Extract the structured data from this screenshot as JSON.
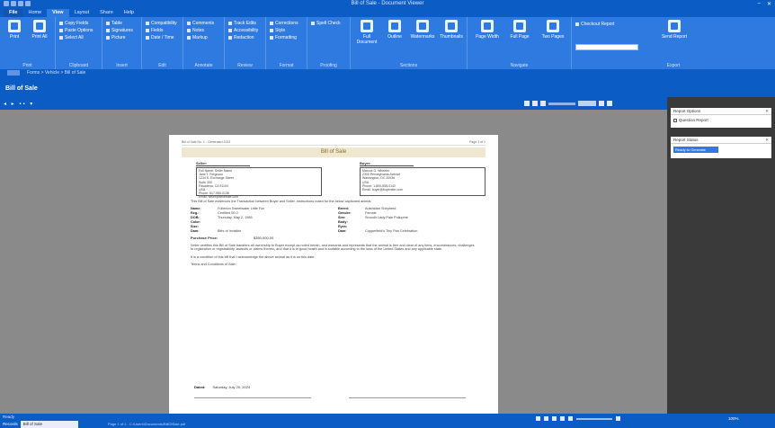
{
  "window": {
    "title": "Bill of Sale - Document Viewer"
  },
  "tabs": [
    {
      "label": "File"
    },
    {
      "label": "Home"
    },
    {
      "label": "View"
    },
    {
      "label": "Layout"
    },
    {
      "label": "Share"
    },
    {
      "label": "Help"
    }
  ],
  "ribbon": {
    "groups": [
      {
        "label": "Print",
        "buttons": [
          "Print",
          "Print All"
        ],
        "small": []
      },
      {
        "label": "Clipboard",
        "buttons": [],
        "small": [
          "Copy Fields",
          "Paste Options",
          "Select All"
        ]
      },
      {
        "label": "Insert",
        "buttons": [],
        "small": [
          "Table",
          "Signatures",
          "Picture"
        ]
      },
      {
        "label": "Edit",
        "buttons": [],
        "small": [
          "Compatibility",
          "Fields",
          "Date / Time"
        ]
      },
      {
        "label": "Annotate",
        "buttons": [],
        "small": [
          "Comments",
          "Notes",
          "Markup"
        ]
      },
      {
        "label": "Review",
        "buttons": [],
        "small": [
          "Track Edits",
          "Accessibility",
          "Redaction"
        ]
      },
      {
        "label": "Format",
        "buttons": [],
        "small": [
          "Corrections",
          "Style",
          "Formatting"
        ]
      },
      {
        "label": "Proofing",
        "buttons": [],
        "small": [
          "Spell Check"
        ]
      },
      {
        "label": "Sections",
        "buttons": [
          "Full Document",
          "Outline",
          "Watermarks",
          "Thumbnails"
        ],
        "small": []
      },
      {
        "label": "Navigate",
        "buttons": [
          "Page Width",
          "Full Page",
          "Two Pages"
        ],
        "small": []
      },
      {
        "label": "Export",
        "buttons": [
          "Send Report"
        ],
        "small": [
          "Checkout Report"
        ]
      }
    ]
  },
  "address": {
    "text": "Forms > Vehicle > Bill of Sale"
  },
  "section": {
    "title": "Bill of Sale"
  },
  "viewer": {
    "zoom": "100%"
  },
  "document": {
    "header_left": "Bill of Sale No. 1 - Generated 2024",
    "header_right": "Page 1 of 1",
    "title": "Bill of Sale",
    "seller": {
      "label": "Seller:",
      "lines": [
        "Full Name: Seller Name",
        "Jane T. Ferguson",
        "1234 S. Exchange Street",
        "Suite 300",
        "Pasadena, CA 91104",
        "USA",
        "Phone: 617-555-0136",
        "Email: seller@sellersite.com"
      ]
    },
    "buyer": {
      "label": "Buyer:",
      "lines": [
        "Marcus G. Wheeler",
        "2300 Pennsylvania Avenue",
        "Washington, DC 20036",
        "USA",
        "Phone: 1-800-555-0142",
        "Email: buyer@buyersite.com"
      ]
    },
    "intro": "This Bill of Sale evidences the Transaction between Buyer and Seller. Instructions noted for the below captioned animal.",
    "fields_left": [
      {
        "k": "Name:",
        "v": "Fullerton Sweetwater Little Fox"
      },
      {
        "k": "Reg.:",
        "v": "Certified 00-0"
      },
      {
        "k": "DOB:",
        "v": "Thursday, May 2, 1985"
      },
      {
        "k": "Color:",
        "v": ""
      },
      {
        "k": "Size:",
        "v": ""
      },
      {
        "k": "Dam:",
        "v": "Bitts of Invisible"
      }
    ],
    "fields_right": [
      {
        "k": "Breed:",
        "v": "Australian Shepherd"
      },
      {
        "k": "Gender:",
        "v": "Female"
      },
      {
        "k": "Sire:",
        "v": "Smooth Lady Pale Pullupme"
      },
      {
        "k": "Body:",
        "v": ""
      },
      {
        "k": "Eyes:",
        "v": ""
      },
      {
        "k": "Dam:",
        "v": "Copperfield's Tiny Pan Celebration"
      }
    ],
    "price_label": "Purchase Price:",
    "price_value": "$350,000.00",
    "para1": "Seller certifies this Bill of Sale transfers all ownership to Buyer except as noted herein, and warrants and represents that the animal is free and clear of any liens, encumbrances, challenges to registration or registrability, lawsuits or claims thereto, and that it is in good health and is suitable according to the laws of the United States and any applicable state.",
    "para2": "It is a condition of this bill that I acknowledge the above animal as it is on this date.",
    "para3": "Terms and Conditions of Sale:",
    "dated_label": "Dated:",
    "dated_value": "Saturday, July 20, 2024"
  },
  "right_panel": {
    "report_options": {
      "title": "Report Options",
      "checkbox_label": "Question Report"
    },
    "report_status": {
      "title": "Report Status",
      "value": "Ready to Generate"
    }
  },
  "statusbar": {
    "line1": "Ready",
    "tab1": "Records",
    "tab2": "Bill of Sale",
    "path": "Page 1 of 1 - C:\\Users\\Documents\\BillOfSale.pdf",
    "zoom": "100%"
  },
  "colors": {
    "accent": "#0b5cc4",
    "ribbon": "#2f7ae0",
    "banner": "#efe7cf"
  }
}
